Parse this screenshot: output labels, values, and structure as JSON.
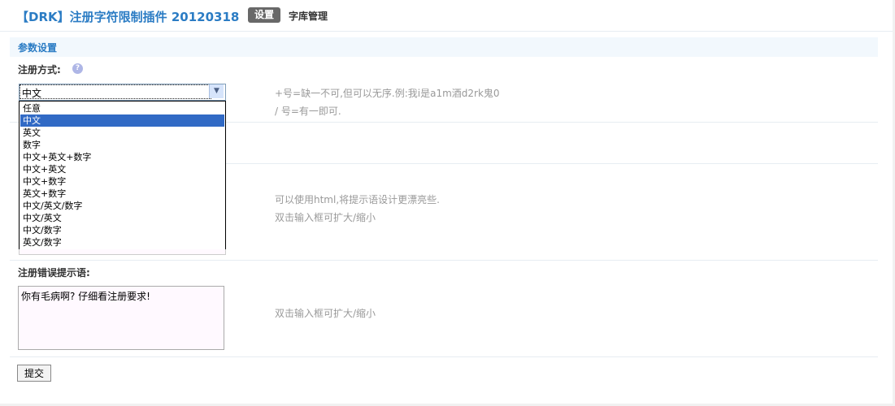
{
  "header": {
    "title": "【DRK】注册字符限制插件 20120318",
    "tabs": [
      {
        "label": "设置",
        "active": true
      },
      {
        "label": "字库管理",
        "active": false
      }
    ]
  },
  "section": {
    "title": "参数设置"
  },
  "settings": {
    "method": {
      "label": "注册方式:",
      "help_icon": "?",
      "selected": "中文",
      "hints": [
        "+号=缺一不可,但可以无序.例:我i是a1m酒d2rk鬼0",
        "/ 号=有一即可."
      ],
      "options": [
        "任意",
        "中文",
        "英文",
        "数字",
        "中文+英文+数字",
        "中文+英文",
        "中文+数字",
        "英文+数字",
        "中文/英文/数字",
        "中文/英文",
        "中文/数字",
        "英文/数字"
      ]
    },
    "tip": {
      "hints": [
        "可以使用html,将提示语设计更漂亮些.",
        "双击输入框可扩大/缩小"
      ]
    },
    "error_tip": {
      "label": "注册错误提示语:",
      "value": "你有毛病啊? 仔细看注册要求!",
      "hint": "双击输入框可扩大/缩小"
    }
  },
  "actions": {
    "submit_label": "提交"
  },
  "colors": {
    "accent": "#2b7cc4",
    "selected_option": "#316ac5"
  }
}
